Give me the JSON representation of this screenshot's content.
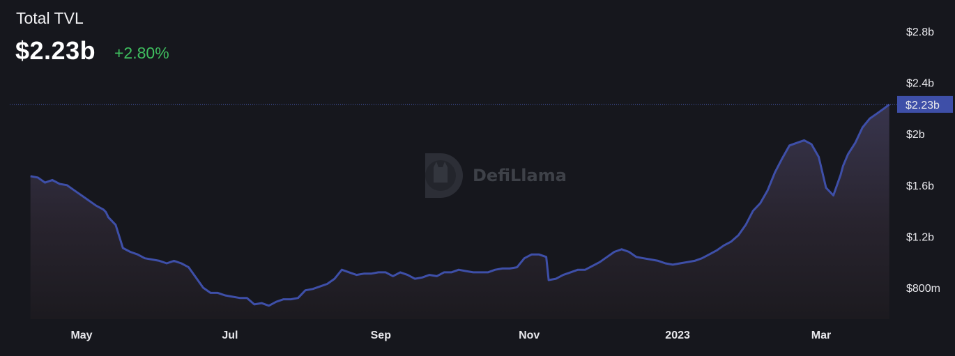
{
  "header": {
    "title": "Total TVL",
    "value": "$2.23b",
    "change": "+2.80%"
  },
  "watermark": {
    "text": "DefiLlama",
    "icon": "llama-logo-icon"
  },
  "colors": {
    "background": "#16171d",
    "line": "#3e4fa8",
    "positive": "#3fbf5f",
    "badge": "#3e4fa8"
  },
  "chart_data": {
    "type": "area",
    "title": "Total TVL",
    "xlabel": "",
    "ylabel": "",
    "yscale": "linear",
    "ylim": [
      650,
      2900
    ],
    "y_tick_values": [
      800,
      1200,
      1600,
      2000,
      2400,
      2800
    ],
    "y_ticks": [
      "$800m",
      "$1.2b",
      "$1.6b",
      "$2b",
      "$2.4b",
      "$2.8b"
    ],
    "x_ticks": [
      "May",
      "Jul",
      "Sep",
      "Nov",
      "2023",
      "Mar"
    ],
    "x_tick_dates": [
      "2022-05-01",
      "2022-07-01",
      "2022-09-01",
      "2022-11-01",
      "2023-01-01",
      "2023-03-01"
    ],
    "current_value_label": "$2.23b",
    "current_value": 2230,
    "grid": false,
    "legend": "none",
    "series": [
      {
        "x": [
          "2022-04-10",
          "2022-04-13",
          "2022-04-16",
          "2022-04-19",
          "2022-04-22",
          "2022-04-25",
          "2022-04-28",
          "2022-05-01",
          "2022-05-04",
          "2022-05-07",
          "2022-05-10",
          "2022-05-11",
          "2022-05-12",
          "2022-05-15",
          "2022-05-18",
          "2022-05-21",
          "2022-05-24",
          "2022-05-27",
          "2022-05-30",
          "2022-06-02",
          "2022-06-05",
          "2022-06-08",
          "2022-06-11",
          "2022-06-14",
          "2022-06-17",
          "2022-06-20",
          "2022-06-23",
          "2022-06-26",
          "2022-06-29",
          "2022-07-02",
          "2022-07-05",
          "2022-07-08",
          "2022-07-11",
          "2022-07-14",
          "2022-07-17",
          "2022-07-20",
          "2022-07-23",
          "2022-07-26",
          "2022-07-29",
          "2022-08-01",
          "2022-08-04",
          "2022-08-07",
          "2022-08-10",
          "2022-08-13",
          "2022-08-16",
          "2022-08-19",
          "2022-08-22",
          "2022-08-25",
          "2022-08-28",
          "2022-08-31",
          "2022-09-03",
          "2022-09-06",
          "2022-09-09",
          "2022-09-12",
          "2022-09-15",
          "2022-09-18",
          "2022-09-21",
          "2022-09-24",
          "2022-09-27",
          "2022-09-30",
          "2022-10-03",
          "2022-10-06",
          "2022-10-09",
          "2022-10-12",
          "2022-10-15",
          "2022-10-18",
          "2022-10-21",
          "2022-10-24",
          "2022-10-27",
          "2022-10-30",
          "2022-11-02",
          "2022-11-05",
          "2022-11-08",
          "2022-11-09",
          "2022-11-12",
          "2022-11-15",
          "2022-11-18",
          "2022-11-21",
          "2022-11-24",
          "2022-11-27",
          "2022-11-30",
          "2022-12-03",
          "2022-12-06",
          "2022-12-09",
          "2022-12-12",
          "2022-12-15",
          "2022-12-18",
          "2022-12-21",
          "2022-12-24",
          "2022-12-27",
          "2022-12-30",
          "2023-01-02",
          "2023-01-05",
          "2023-01-08",
          "2023-01-11",
          "2023-01-14",
          "2023-01-17",
          "2023-01-20",
          "2023-01-23",
          "2023-01-26",
          "2023-01-29",
          "2023-02-01",
          "2023-02-04",
          "2023-02-07",
          "2023-02-10",
          "2023-02-13",
          "2023-02-16",
          "2023-02-19",
          "2023-02-22",
          "2023-02-25",
          "2023-02-28",
          "2023-03-03",
          "2023-03-06",
          "2023-03-09",
          "2023-03-10",
          "2023-03-12",
          "2023-03-15",
          "2023-03-18",
          "2023-03-21",
          "2023-03-24",
          "2023-03-27",
          "2023-03-29"
        ],
        "values": [
          1670,
          1660,
          1620,
          1640,
          1610,
          1600,
          1560,
          1520,
          1480,
          1440,
          1410,
          1390,
          1350,
          1290,
          1110,
          1080,
          1060,
          1030,
          1020,
          1010,
          990,
          1010,
          990,
          960,
          880,
          800,
          760,
          760,
          740,
          730,
          720,
          720,
          670,
          680,
          660,
          690,
          710,
          710,
          720,
          780,
          790,
          810,
          830,
          870,
          940,
          920,
          900,
          910,
          910,
          920,
          920,
          890,
          920,
          900,
          870,
          880,
          900,
          890,
          920,
          920,
          940,
          930,
          920,
          920,
          920,
          940,
          950,
          950,
          960,
          1030,
          1060,
          1060,
          1040,
          860,
          870,
          900,
          920,
          940,
          940,
          970,
          1000,
          1040,
          1080,
          1100,
          1080,
          1040,
          1030,
          1020,
          1010,
          990,
          980,
          990,
          1000,
          1010,
          1030,
          1060,
          1090,
          1130,
          1160,
          1210,
          1290,
          1400,
          1460,
          1560,
          1700,
          1810,
          1910,
          1930,
          1950,
          1920,
          1820,
          1580,
          1520,
          1680,
          1750,
          1840,
          1930,
          2050,
          2120,
          2160,
          2200,
          2230
        ]
      }
    ]
  }
}
